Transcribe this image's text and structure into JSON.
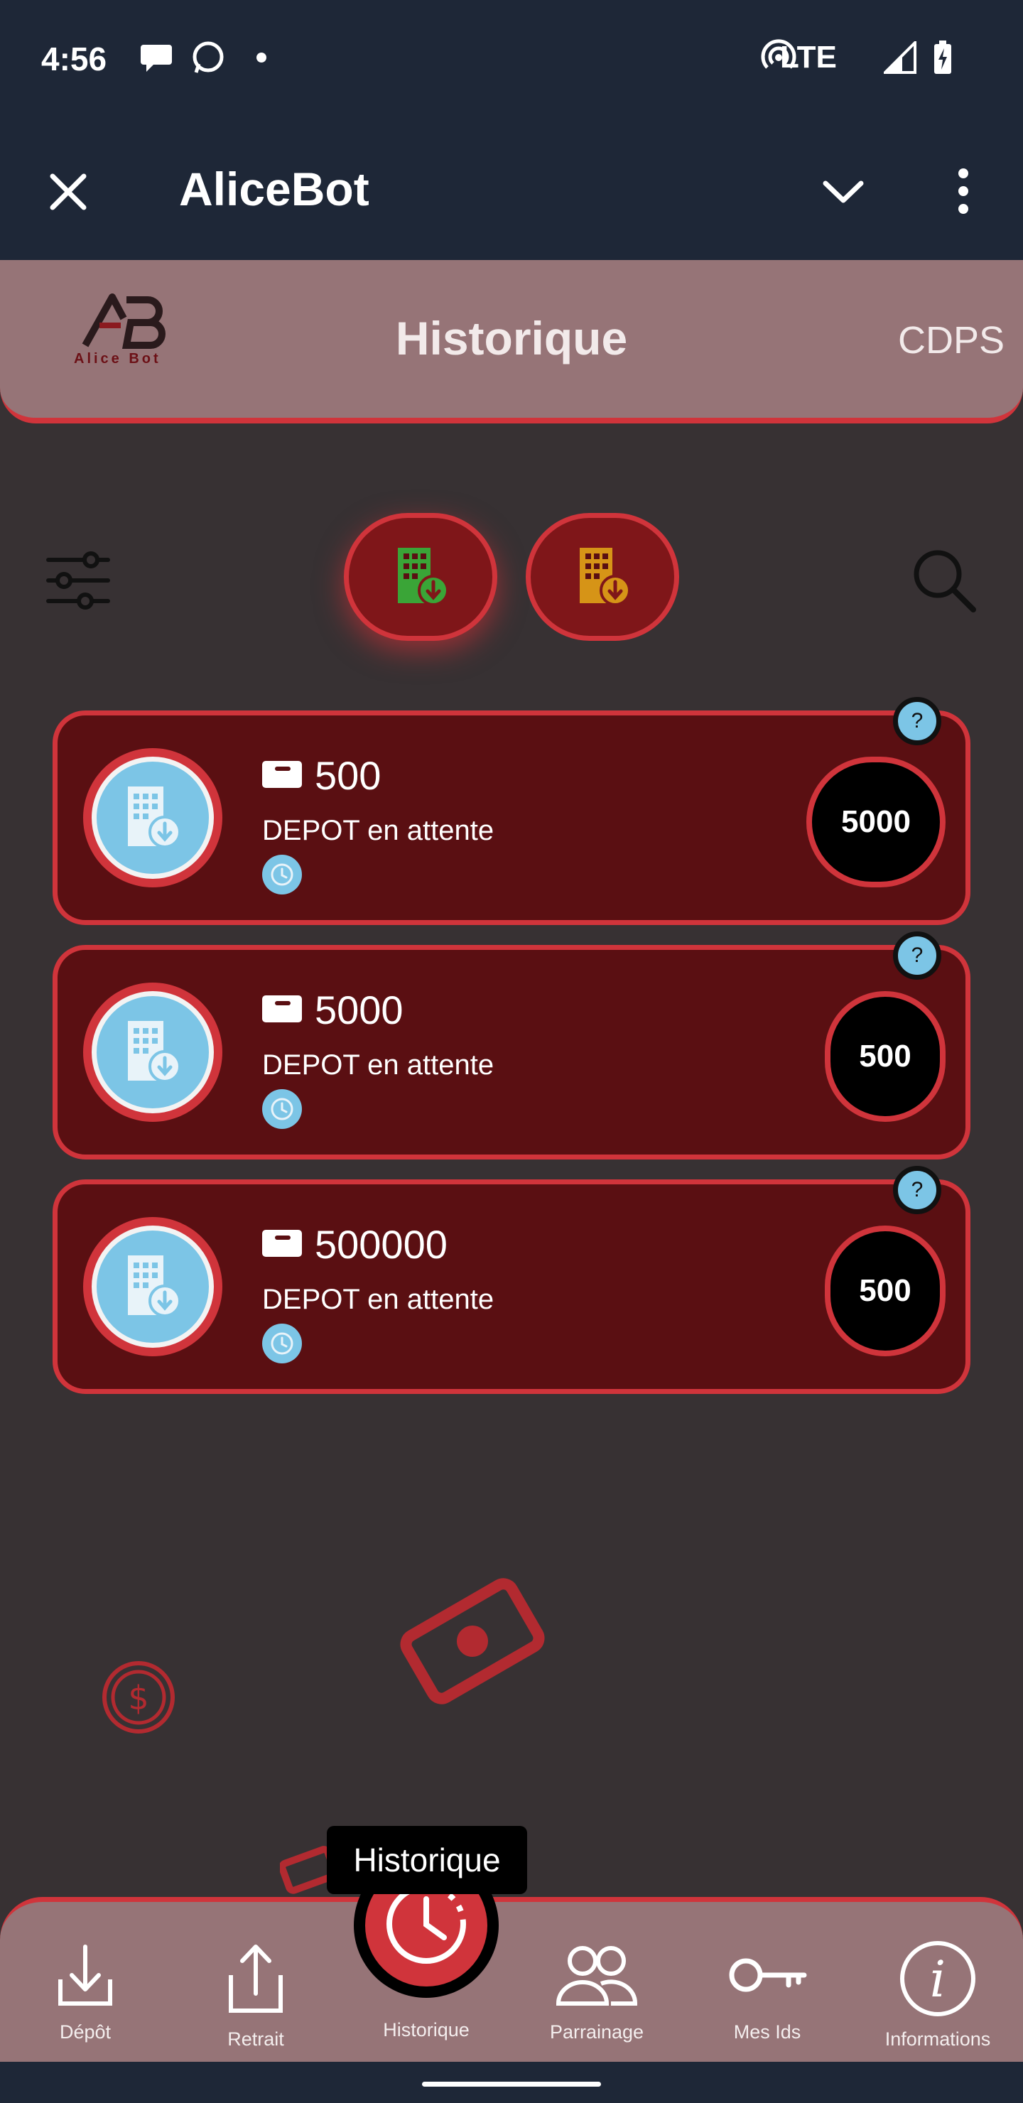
{
  "status": {
    "time": "4:56",
    "network": "LTE"
  },
  "appbar": {
    "title": "AliceBot"
  },
  "header": {
    "title": "Historique",
    "right_text": "CDPS",
    "logo_text": "Alice Bot"
  },
  "cards": [
    {
      "amount": "500",
      "status": "DEPOT en attente",
      "badge": "5000",
      "help": "?"
    },
    {
      "amount": "5000",
      "status": "DEPOT en attente",
      "badge": "500",
      "help": "?"
    },
    {
      "amount": "500000",
      "status": "DEPOT en attente",
      "badge": "500",
      "help": "?"
    }
  ],
  "tooltip": "Historique",
  "nav": {
    "depot": "Dépôt",
    "retrait": "Retrait",
    "historique": "Historique",
    "parrainage": "Parrainage",
    "mes_ids": "Mes Ids",
    "informations": "Informations"
  },
  "colors": {
    "dark_bar": "#1e2737",
    "header_band": "#967477",
    "accent_red": "#d0343b",
    "card_bg": "#5a0f12",
    "light_blue": "#7cc5e6",
    "green_icon": "#3aa537",
    "amber_icon": "#d69417"
  },
  "icons": [
    "close-icon",
    "chevron-down-icon",
    "more-vert-icon",
    "filter-sliders-icon",
    "search-icon",
    "building-download-icon",
    "wallet-icon",
    "clock-icon",
    "help-icon",
    "download-icon",
    "upload-icon",
    "history-clock-icon",
    "people-icon",
    "key-icon",
    "info-icon"
  ]
}
